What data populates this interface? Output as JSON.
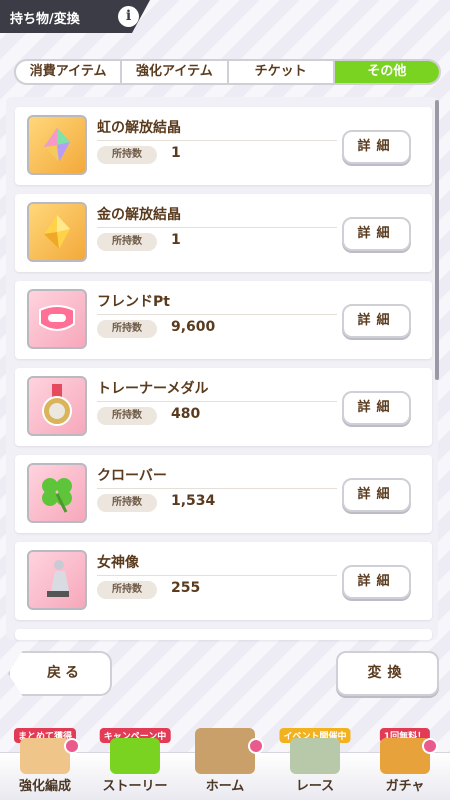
{
  "header": {
    "title": "持ち物/変換",
    "info_icon": "info-icon"
  },
  "tabs": [
    {
      "label": "消費アイテム",
      "active": false
    },
    {
      "label": "強化アイテム",
      "active": false
    },
    {
      "label": "チケット",
      "active": false
    },
    {
      "label": "その他",
      "active": true
    }
  ],
  "qty_label": "所持数",
  "detail_label": "詳細",
  "items": [
    {
      "name": "虹の解放結晶",
      "qty": "1",
      "icon": "rainbow-crystal-icon"
    },
    {
      "name": "金の解放結晶",
      "qty": "1",
      "icon": "gold-crystal-icon"
    },
    {
      "name": "フレンドPt",
      "qty": "9,600",
      "icon": "friend-handshake-icon"
    },
    {
      "name": "トレーナーメダル",
      "qty": "480",
      "icon": "trainer-medal-icon"
    },
    {
      "name": "クローバー",
      "qty": "1,534",
      "icon": "clover-icon"
    },
    {
      "name": "女神像",
      "qty": "255",
      "icon": "goddess-statue-icon"
    }
  ],
  "buttons": {
    "back": "戻る",
    "convert": "変換"
  },
  "nav": [
    {
      "label": "強化編成",
      "badge": "まとめて獲得"
    },
    {
      "label": "ストーリー",
      "badge": "キャンペーン中"
    },
    {
      "label": "ホーム",
      "badge": ""
    },
    {
      "label": "レース",
      "badge": "イベント開催中"
    },
    {
      "label": "ガチャ",
      "badge": "1回無料！"
    }
  ],
  "colors": {
    "tab_active": "#7bd321",
    "text_brown": "#5a3b1e",
    "header_dark": "#3c3c46"
  }
}
